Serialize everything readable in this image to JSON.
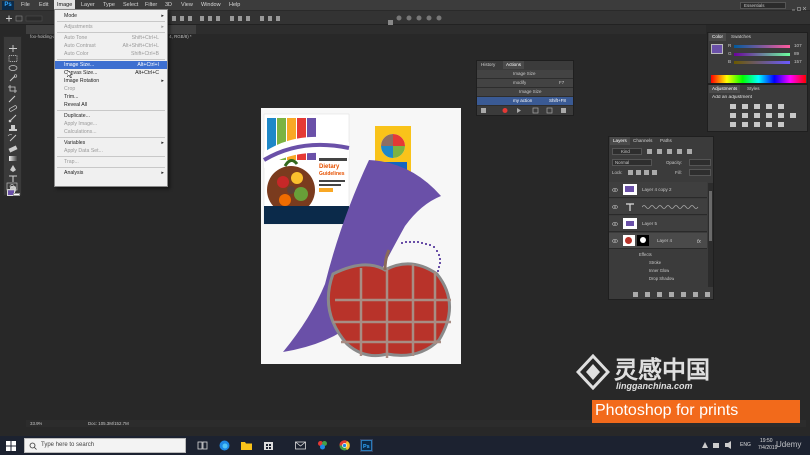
{
  "menubar": {
    "logo": "Ps",
    "items": [
      "File",
      "Edit",
      "Image",
      "Layer",
      "Type",
      "Select",
      "Filter",
      "3D",
      "View",
      "Window",
      "Help"
    ],
    "active": "Image",
    "workspace": "Essentials"
  },
  "document_tab": "foo-holding-apple clipart clipart colour white apple.png @ 36.7% (Layer 4, RGB/8) *",
  "image_menu": {
    "items": [
      {
        "label": "Mode",
        "shortcut": "",
        "arrow": true,
        "disabled": false,
        "highlight": false
      },
      {
        "sep": true
      },
      {
        "label": "Adjustments",
        "shortcut": "",
        "arrow": true,
        "disabled": true,
        "highlight": false
      },
      {
        "sep": true
      },
      {
        "label": "Auto Tone",
        "shortcut": "Shift+Ctrl+L",
        "arrow": false,
        "disabled": true,
        "highlight": false
      },
      {
        "label": "Auto Contrast",
        "shortcut": "Alt+Shift+Ctrl+L",
        "arrow": false,
        "disabled": true,
        "highlight": false
      },
      {
        "label": "Auto Color",
        "shortcut": "Shift+Ctrl+B",
        "arrow": false,
        "disabled": true,
        "highlight": false
      },
      {
        "sep": true
      },
      {
        "label": "Image Size...",
        "shortcut": "Alt+Ctrl+I",
        "arrow": false,
        "disabled": false,
        "highlight": true
      },
      {
        "label": "Canvas Size...",
        "shortcut": "Alt+Ctrl+C",
        "arrow": false,
        "disabled": false,
        "highlight": false
      },
      {
        "label": "Image Rotation",
        "shortcut": "",
        "arrow": true,
        "disabled": false,
        "highlight": false
      },
      {
        "label": "Crop",
        "shortcut": "",
        "arrow": false,
        "disabled": true,
        "highlight": false
      },
      {
        "label": "Trim...",
        "shortcut": "",
        "arrow": false,
        "disabled": false,
        "highlight": false
      },
      {
        "label": "Reveal All",
        "shortcut": "",
        "arrow": false,
        "disabled": false,
        "highlight": false
      },
      {
        "sep": true
      },
      {
        "label": "Duplicate...",
        "shortcut": "",
        "arrow": false,
        "disabled": false,
        "highlight": false
      },
      {
        "label": "Apply Image...",
        "shortcut": "",
        "arrow": false,
        "disabled": true,
        "highlight": false
      },
      {
        "label": "Calculations...",
        "shortcut": "",
        "arrow": false,
        "disabled": true,
        "highlight": false
      },
      {
        "sep": true
      },
      {
        "label": "Variables",
        "shortcut": "",
        "arrow": true,
        "disabled": false,
        "highlight": false
      },
      {
        "label": "Apply Data Set...",
        "shortcut": "",
        "arrow": false,
        "disabled": true,
        "highlight": false
      },
      {
        "sep": true
      },
      {
        "label": "Trap...",
        "shortcut": "",
        "arrow": false,
        "disabled": true,
        "highlight": false
      },
      {
        "sep": true
      },
      {
        "label": "Analysis",
        "shortcut": "",
        "arrow": true,
        "disabled": false,
        "highlight": false
      }
    ]
  },
  "canvas_text": {
    "dietary": "Dietary",
    "guidelines": "Guidelines"
  },
  "actions_panel": {
    "tabs": [
      "History",
      "Actions"
    ],
    "rows": [
      "Image Size",
      "modify",
      "Image Size",
      "my action"
    ],
    "shortcuts": [
      "",
      "F7",
      "",
      "Shift+F8"
    ]
  },
  "color_panel": {
    "tabs": [
      "Color",
      "Swatches"
    ],
    "channels": [
      {
        "label": "R",
        "value": "107"
      },
      {
        "label": "G",
        "value": "89"
      },
      {
        "label": "B",
        "value": "157"
      }
    ]
  },
  "adjustments_panel": {
    "tabs": [
      "Adjustments",
      "Styles"
    ],
    "heading": "Add an adjustment"
  },
  "layers_panel": {
    "tabs": [
      "Layers",
      "Channels",
      "Paths"
    ],
    "kind": "Kind",
    "blend": "Normal",
    "opacity_label": "Opacity:",
    "fill_label": "Fill:",
    "lock_label": "Lock:",
    "layers": [
      "Layer 4 copy 2",
      "",
      "Layer 5",
      "Layer 4"
    ],
    "effects": [
      "Effects",
      "Stroke",
      "Inner Glow",
      "Drop Shadow"
    ]
  },
  "status": {
    "zoom": "33.9%",
    "doc": "Doc: 105.3M/152.7M"
  },
  "taskbar": {
    "search_placeholder": "Type here to search",
    "lang": "ENG",
    "time": "19:50",
    "date": "7/4/2019"
  },
  "watermark": {
    "cn": "灵感中国",
    "url": "lingganchina.com"
  },
  "promo": "Photoshop for prints",
  "udemy": "Udemy",
  "colors": {
    "accent": "#6a50a8",
    "purple_shape": "#6a50a8",
    "apple_red": "#c0392b",
    "promo_orange": "#f26a1b",
    "ps_blue": "#31a8ff"
  }
}
